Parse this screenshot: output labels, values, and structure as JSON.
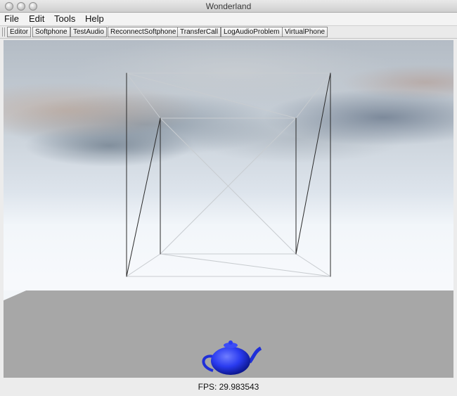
{
  "window": {
    "title": "Wonderland"
  },
  "menus": [
    "File",
    "Edit",
    "Tools",
    "Help"
  ],
  "toolbar": [
    "Editor",
    "Softphone",
    "TestAudio",
    "ReconnectSoftphone",
    "TransferCall",
    "LogAudioProblem",
    "VirtualPhone"
  ],
  "status": {
    "fps": "FPS: 29.983543"
  },
  "scene": {
    "sky_color": "#f7f9fc",
    "floor_color": "#a7a7a7",
    "teapot_color": "#2a3bf0",
    "wire_color": "#2b2b2b"
  }
}
